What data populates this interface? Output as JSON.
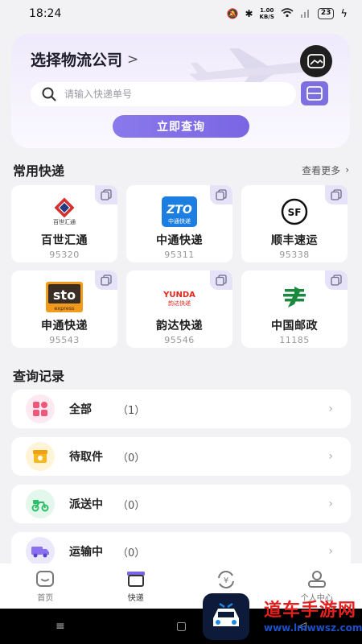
{
  "status_bar": {
    "time": "18:24",
    "net_speed_value": "1.00",
    "net_speed_unit": "KB/S",
    "battery": "23"
  },
  "search_card": {
    "title": "选择物流公司",
    "title_chevron": ">",
    "search_placeholder": "请输入快递单号",
    "query_button": "立即查询"
  },
  "common_couriers": {
    "section_title": "常用快递",
    "more_label": "查看更多",
    "items": [
      {
        "name": "百世汇通",
        "phone": "95320",
        "logo_text": "百世汇通",
        "logo_icon": "best-express-logo"
      },
      {
        "name": "中通快递",
        "phone": "95311",
        "logo_text": "ZTO",
        "logo_sub": "中通快递",
        "logo_icon": "zto-logo"
      },
      {
        "name": "顺丰速运",
        "phone": "95338",
        "logo_text": "SF",
        "logo_icon": "sf-logo"
      },
      {
        "name": "申通快递",
        "phone": "95543",
        "logo_text": "sto",
        "logo_sub": "express",
        "logo_icon": "sto-logo"
      },
      {
        "name": "韵达快递",
        "phone": "95546",
        "logo_text": "YUNDA",
        "logo_sub": "韵达快递",
        "logo_icon": "yunda-logo"
      },
      {
        "name": "中国邮政",
        "phone": "11185",
        "logo_icon": "china-post-logo"
      }
    ]
  },
  "query_records": {
    "section_title": "查询记录",
    "rows": [
      {
        "label": "全部",
        "count": "（1）",
        "icon": "grid-icon"
      },
      {
        "label": "待取件",
        "count": "（0）",
        "icon": "pickup-box-icon"
      },
      {
        "label": "派送中",
        "count": "（0）",
        "icon": "delivery-scooter-icon"
      },
      {
        "label": "运输中",
        "count": "（0）",
        "icon": "truck-icon"
      }
    ]
  },
  "tab_bar": {
    "tabs": [
      {
        "label": "首页",
        "icon": "home-icon"
      },
      {
        "label": "快递",
        "icon": "package-icon"
      },
      {
        "label": "",
        "icon": "yuan-refresh-icon"
      },
      {
        "label": "个人中心",
        "icon": "profile-icon"
      }
    ]
  },
  "watermark": {
    "cn": "道车手游网",
    "url": "www.lmwwsz.com"
  },
  "colors": {
    "accent": "#7a66e3",
    "card_bg": "#f3effc",
    "page_bg": "#f2f2f5"
  }
}
